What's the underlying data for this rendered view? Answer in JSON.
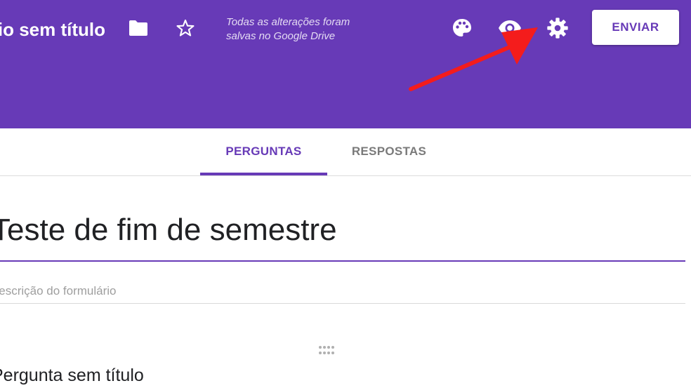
{
  "header": {
    "doc_title": "Formulário sem título",
    "save_status_line1": "Todas as alterações foram",
    "save_status_line2": "salvas no Google Drive",
    "send_label": "ENVIAR",
    "icons": [
      "folder-icon",
      "star-icon",
      "palette-icon",
      "eye-icon",
      "gear-icon"
    ]
  },
  "tabs": [
    {
      "label": "PERGUNTAS",
      "active": true
    },
    {
      "label": "RESPOSTAS",
      "active": false
    }
  ],
  "form": {
    "title": "Teste de fim de semestre",
    "description_placeholder": "Descrição do formulário",
    "question_title": "Pergunta sem título"
  },
  "colors": {
    "brand": "#673ab7",
    "annotation_arrow": "#f41c1c"
  }
}
